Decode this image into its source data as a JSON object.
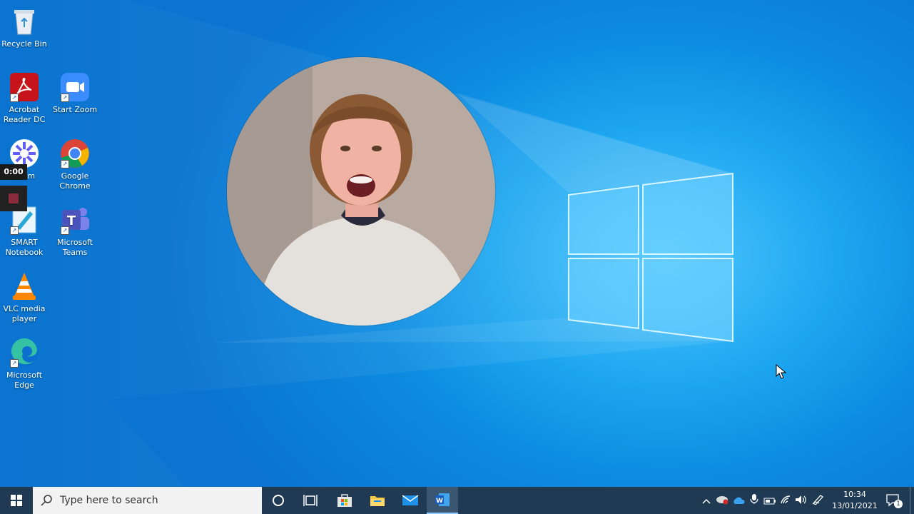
{
  "desktop": {
    "icons": [
      {
        "label": "Recycle Bin"
      },
      {
        "label": "Acrobat Reader DC"
      },
      {
        "label": "Start Zoom"
      },
      {
        "label": "Loom"
      },
      {
        "label": "Google Chrome"
      },
      {
        "label": "SMART Notebook"
      },
      {
        "label": "Microsoft Teams"
      },
      {
        "label": "VLC media player"
      },
      {
        "label": "Microsoft Edge"
      }
    ]
  },
  "recorder": {
    "timer": "0:00"
  },
  "taskbar": {
    "search_placeholder": "Type here to search",
    "clock": {
      "time": "10:34",
      "date": "13/01/2021"
    },
    "notification_count": "1"
  },
  "colors": {
    "taskbar": "#1f3a52",
    "desktop_accent": "#1da6f0"
  }
}
